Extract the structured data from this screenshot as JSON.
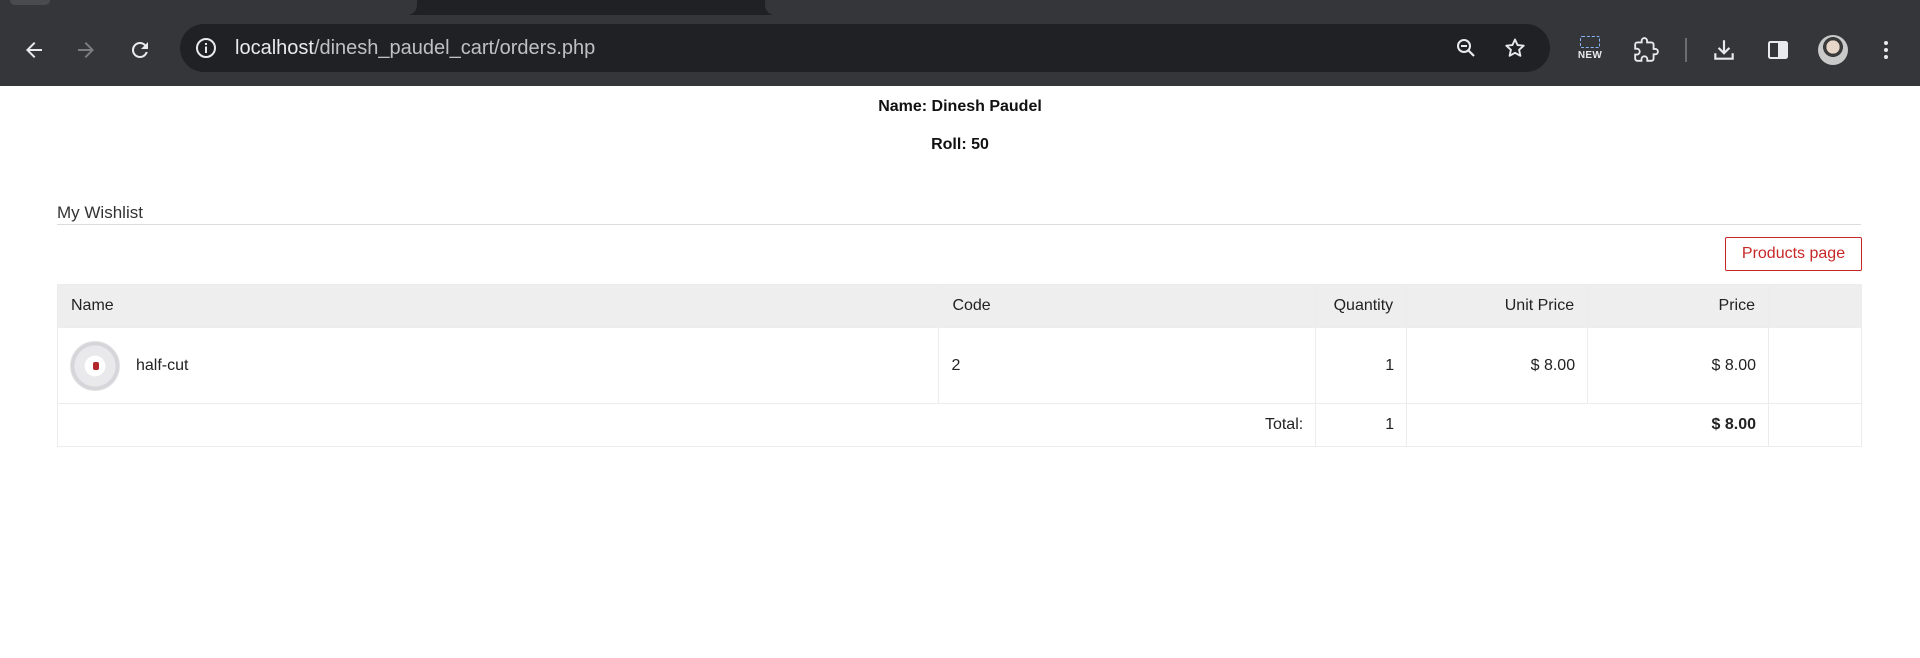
{
  "browser": {
    "url_host": "localhost",
    "url_path": "/dinesh_paudel_cart/orders.php",
    "new_badge": "NEW",
    "icons": [
      "back-icon",
      "forward-icon",
      "reload-icon",
      "site-info-icon",
      "zoom-icon",
      "bookmark-star-icon",
      "lens-new-icon",
      "extensions-icon",
      "download-icon",
      "side-panel-icon",
      "profile-avatar",
      "more-menu-icon"
    ]
  },
  "student": {
    "name": "Name: Dinesh Paudel",
    "roll": "Roll: 50"
  },
  "wishlist": {
    "title": "My Wishlist",
    "products_button": "Products page"
  },
  "table": {
    "headers": {
      "name": "Name",
      "code": "Code",
      "quantity": "Quantity",
      "unit_price": "Unit Price",
      "price": "Price"
    },
    "rows": [
      {
        "name": "half-cut",
        "code": "2",
        "quantity": "1",
        "unit_price": "$ 8.00",
        "price": "$ 8.00"
      }
    ],
    "total": {
      "label": "Total:",
      "quantity": "1",
      "price": "$ 8.00"
    }
  },
  "colors": {
    "chrome_bg": "#35363a",
    "omnibox_bg": "#202124",
    "accent_red": "#c62828",
    "table_header_bg": "#eeeeee"
  }
}
